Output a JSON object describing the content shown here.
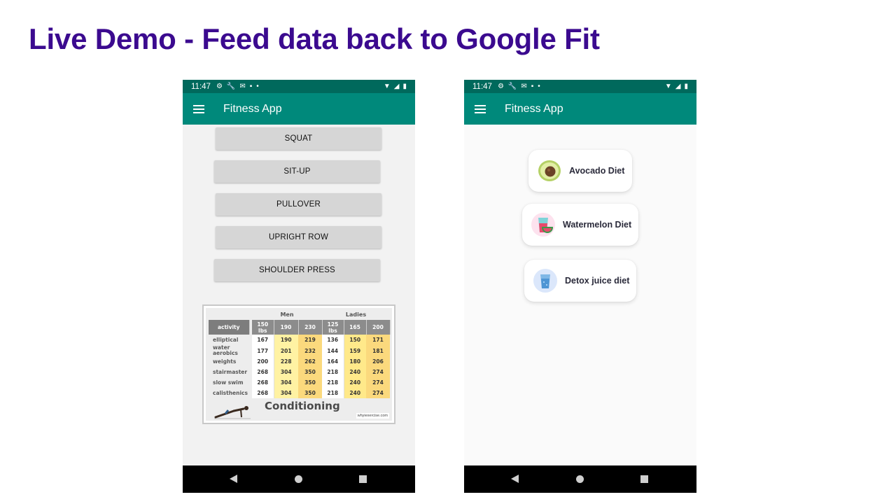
{
  "slide": {
    "title": "Live Demo - Feed data back to Google Fit",
    "title_color": "#3b0a8f"
  },
  "statusbar": {
    "time": "11:47",
    "color": "#00695c"
  },
  "appbar": {
    "title": "Fitness App",
    "color": "#00897b"
  },
  "exercises": [
    "SQUAT",
    "SIT-UP",
    "PULLOVER",
    "UPRIGHT ROW",
    "SHOULDER PRESS"
  ],
  "conditioning_chart": {
    "group_men": "Men",
    "group_ladies": "Ladies",
    "activity_header": "activity",
    "columns": [
      "150 lbs",
      "190",
      "230",
      "125 lbs",
      "165",
      "200"
    ],
    "rows": [
      {
        "activity": "elliptical",
        "values": [
          "167",
          "190",
          "219",
          "136",
          "150",
          "171"
        ]
      },
      {
        "activity": "water aerobics",
        "values": [
          "177",
          "201",
          "232",
          "144",
          "159",
          "181"
        ]
      },
      {
        "activity": "weights",
        "values": [
          "200",
          "228",
          "262",
          "164",
          "180",
          "206"
        ]
      },
      {
        "activity": "stairmaster",
        "values": [
          "268",
          "304",
          "350",
          "218",
          "240",
          "274"
        ]
      },
      {
        "activity": "slow swim",
        "values": [
          "268",
          "304",
          "350",
          "218",
          "240",
          "274"
        ]
      },
      {
        "activity": "calisthenics",
        "values": [
          "268",
          "304",
          "350",
          "218",
          "240",
          "274"
        ]
      }
    ],
    "title": "Conditioning",
    "credit": "whyiexercise.com"
  },
  "diets": [
    {
      "label": "Avocado Diet",
      "icon": "avocado-icon"
    },
    {
      "label": "Watermelon Diet",
      "icon": "watermelon-icon"
    },
    {
      "label": "Detox juice diet",
      "icon": "detox-juice-icon"
    }
  ]
}
